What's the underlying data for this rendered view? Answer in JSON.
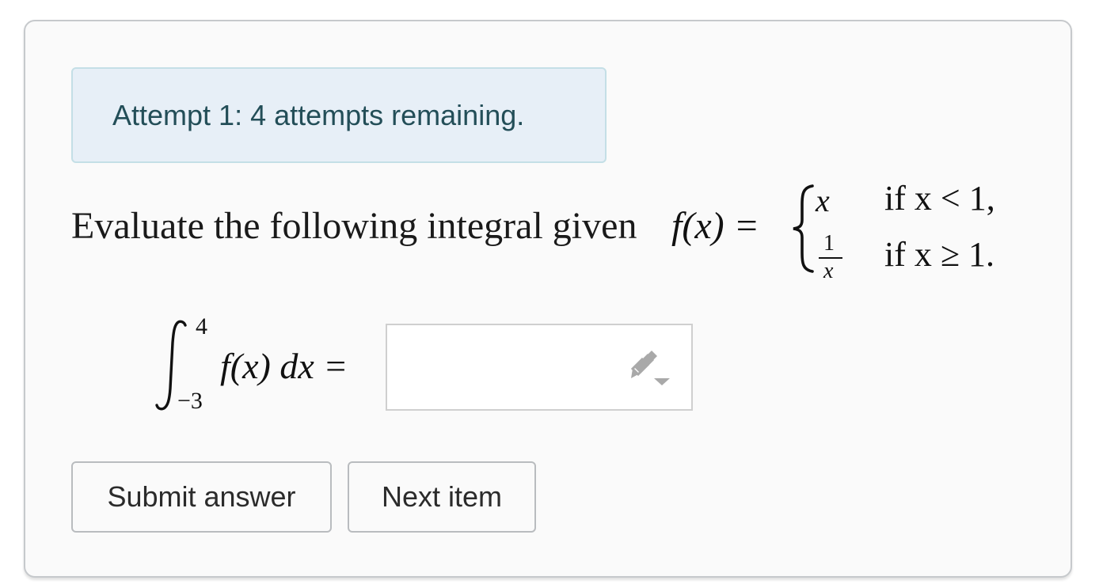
{
  "alert": {
    "text": "Attempt 1: 4 attempts remaining."
  },
  "question": {
    "prompt": "Evaluate the following integral given",
    "function_lhs": "f(x) =",
    "cases": [
      {
        "value": "x",
        "condition": "if x < 1,"
      },
      {
        "value_num": "1",
        "value_den": "x",
        "condition": "if x ≥ 1."
      }
    ],
    "integral": {
      "upper": "4",
      "lower": "−3",
      "integrand": "f(x) dx ="
    }
  },
  "answer_input": {
    "value": "",
    "placeholder": ""
  },
  "buttons": {
    "submit_label": "Submit answer",
    "next_label": "Next item"
  }
}
